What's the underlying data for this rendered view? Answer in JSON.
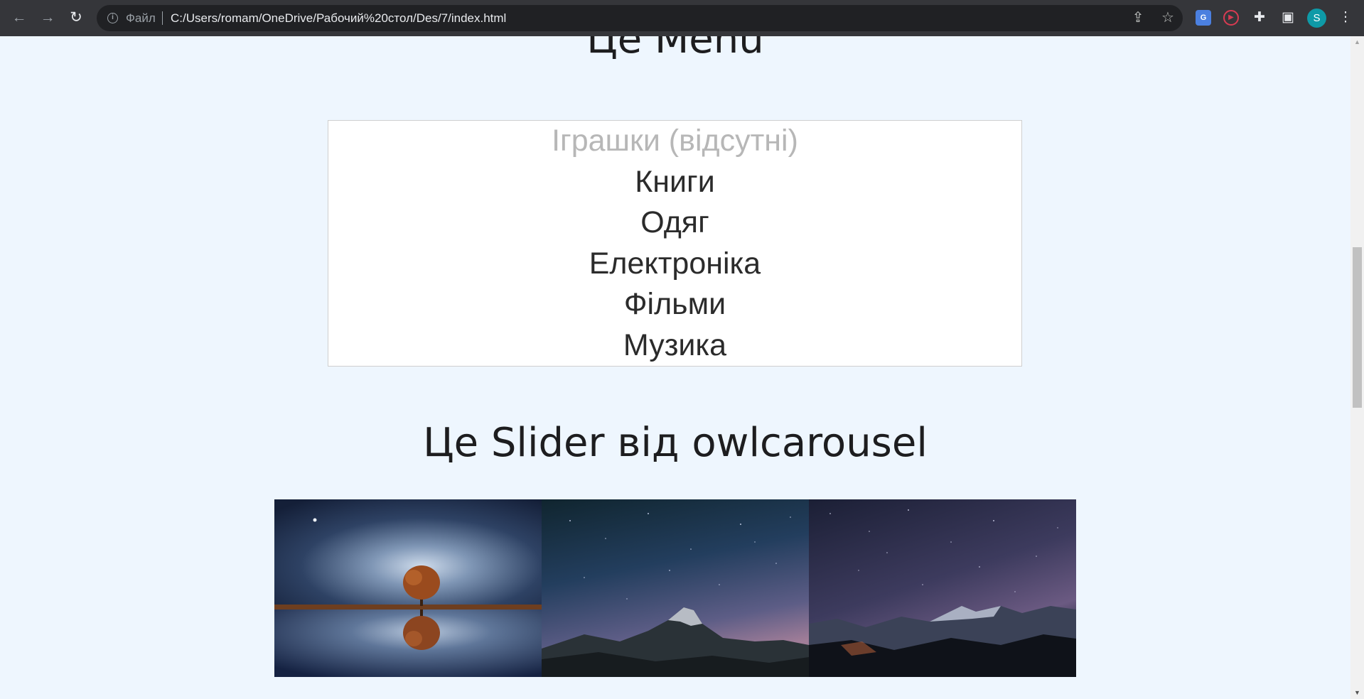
{
  "browser": {
    "back_icon": "arrow-left-icon",
    "forward_icon": "arrow-right-icon",
    "reload_icon": "reload-icon",
    "scheme_label": "Файл",
    "url": "C:/Users/romam/OneDrive/Рабочий%20стол/Des/7/index.html",
    "profile_initial": "S"
  },
  "page": {
    "menu_title": "Це Menu",
    "menu_items": [
      {
        "label": "Іграшки (відсутні)",
        "disabled": true
      },
      {
        "label": "Книги",
        "disabled": false
      },
      {
        "label": "Одяг",
        "disabled": false
      },
      {
        "label": "Електроніка",
        "disabled": false
      },
      {
        "label": "Фільми",
        "disabled": false
      },
      {
        "label": "Музика",
        "disabled": false
      }
    ],
    "slider_title": "Це Slider від owlcarousel",
    "slides": [
      "tree-reflection-night-image",
      "starry-mountain-peak-image",
      "milky-way-mountains-image"
    ]
  },
  "colors": {
    "page_background": "#eef6fe",
    "chrome_background": "#35363a",
    "omnibox_background": "#202124",
    "disabled_text": "#b7b7b7"
  }
}
